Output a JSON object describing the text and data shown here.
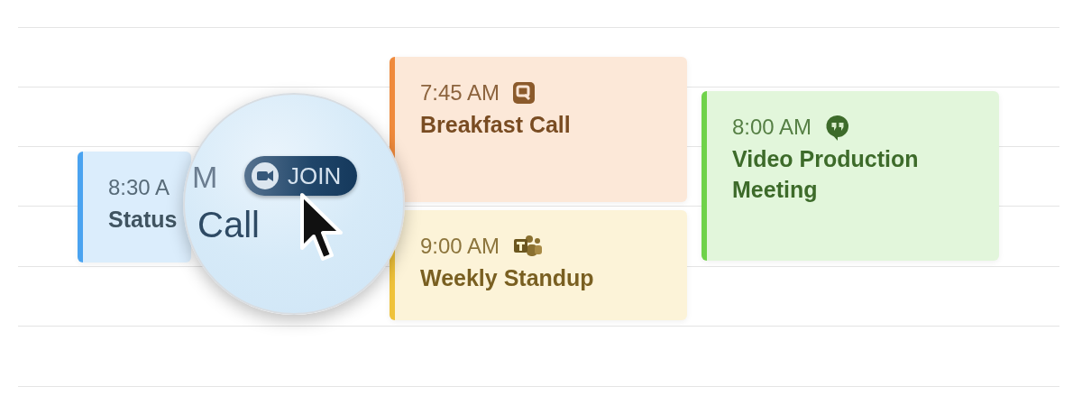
{
  "calendar": {
    "events": [
      {
        "time": "8:30 A",
        "title": "Status",
        "color": "#4aa3f0"
      },
      {
        "time": "7:45 AM",
        "title": "Breakfast Call",
        "color": "#ef8a3c"
      },
      {
        "time": "9:00 AM",
        "title": "Weekly Standup",
        "color": "#efc23a"
      },
      {
        "time": "8:00 AM",
        "title": "Video Production Meeting",
        "color": "#6fd24a"
      }
    ]
  },
  "magnifier": {
    "time_fragment": "M",
    "join_button": "JOIN",
    "title_fragment": "Call"
  }
}
